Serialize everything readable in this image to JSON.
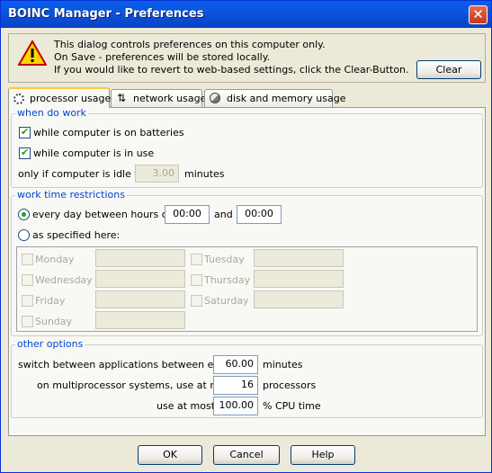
{
  "window": {
    "title": "BOINC Manager - Preferences",
    "close_glyph": "✕"
  },
  "info": {
    "icon": "warning-icon",
    "lines": [
      "This dialog controls preferences on this computer only.",
      "On Save - preferences will be stored locally.",
      "If you would like to revert to web-based settings, click the Clear-Button."
    ],
    "clear_label": "Clear"
  },
  "tabs": [
    {
      "label": "processor usage",
      "icon": "processor-icon",
      "active": true
    },
    {
      "label": "network usage",
      "icon": "network-icon",
      "active": false
    },
    {
      "label": "disk and memory usage",
      "icon": "disk-icon",
      "active": false
    }
  ],
  "when_do_work": {
    "legend": "when do work",
    "on_batteries_label": "while computer is on batteries",
    "on_batteries_checked": true,
    "in_use_label": "while computer is in use",
    "in_use_checked": true,
    "idle_label": "only if computer is idle for",
    "idle_value": "3.00",
    "idle_unit": "minutes"
  },
  "work_time": {
    "legend": "work time restrictions",
    "every_day_label": "every day between hours of",
    "every_day_selected": true,
    "start_time": "00:00",
    "and_label": "and",
    "end_time": "00:00",
    "specified_label": "as specified here:",
    "days": {
      "monday": "Monday",
      "tuesday": "Tuesday",
      "wednesday": "Wednesday",
      "thursday": "Thursday",
      "friday": "Friday",
      "saturday": "Saturday",
      "sunday": "Sunday"
    }
  },
  "other": {
    "legend": "other options",
    "switch_label": "switch between applications between every",
    "switch_value": "60.00",
    "switch_unit": "minutes",
    "multiproc_label": "on multiprocessor systems, use at most",
    "multiproc_value": "16",
    "multiproc_unit": "processors",
    "cpu_label": "use at most",
    "cpu_value": "100.00",
    "cpu_unit": "% CPU time"
  },
  "footer": {
    "ok_label": "OK",
    "cancel_label": "Cancel",
    "help_label": "Help"
  }
}
